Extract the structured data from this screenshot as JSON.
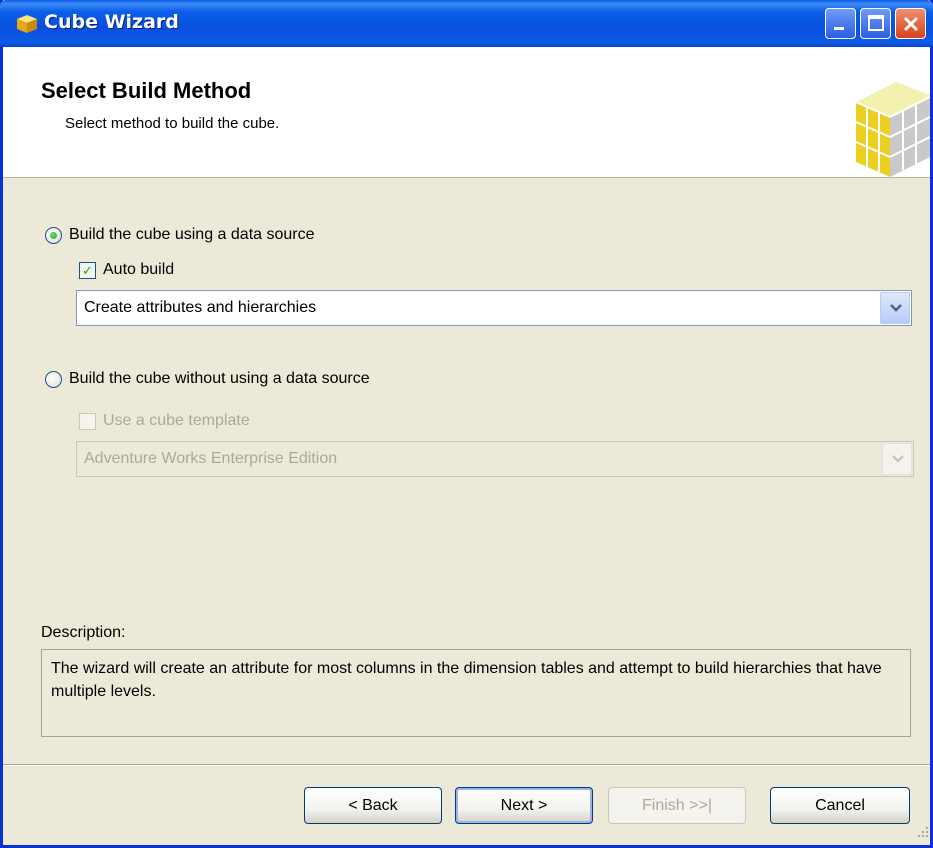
{
  "window": {
    "title": "Cube Wizard",
    "controls": {
      "minimize": "minimize",
      "maximize": "maximize",
      "close": "close"
    }
  },
  "header": {
    "title": "Select Build Method",
    "subtitle": "Select method to build the cube."
  },
  "options": {
    "build_with_source": {
      "label": "Build the cube using a data source",
      "selected": true,
      "auto_build": {
        "label": "Auto build",
        "checked": true
      },
      "combo": {
        "value": "Create attributes and hierarchies"
      }
    },
    "build_without_source": {
      "label": "Build the cube without using a data source",
      "selected": false,
      "template": {
        "label": "Use a cube template",
        "checked": false,
        "enabled": false
      },
      "combo": {
        "value": "Adventure Works Enterprise Edition",
        "enabled": false
      }
    }
  },
  "description": {
    "label": "Description:",
    "text": "The wizard will create an attribute for most columns in the dimension tables and attempt to build hierarchies that have multiple levels."
  },
  "buttons": {
    "back": "< Back",
    "next": "Next >",
    "finish": "Finish >>|",
    "cancel": "Cancel"
  },
  "colors": {
    "titlebar": "#0a5ce6",
    "dialog_bg": "#ece9d8",
    "header_bg": "#ffffff",
    "radio_check": "#21a121",
    "disabled_text": "#aca899"
  }
}
